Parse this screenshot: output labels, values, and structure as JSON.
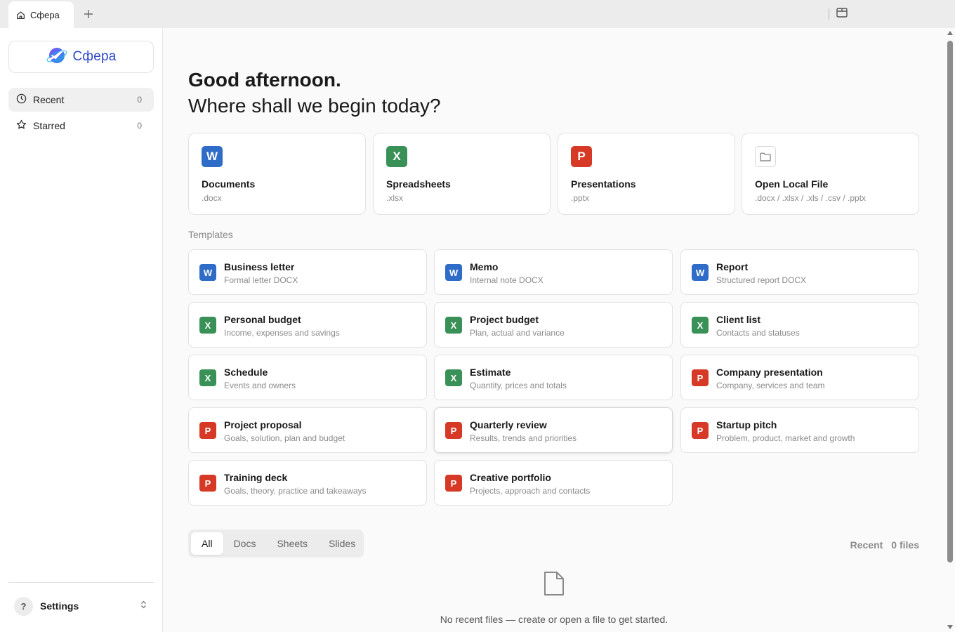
{
  "tabbar": {
    "tab_title": "Сфера",
    "tab_icon": "home-icon",
    "add_tab_icon": "plus-icon",
    "panel_icon": "sidebar-panel-icon"
  },
  "sidebar": {
    "logo_text": "Сфера",
    "logo_icon": "sphere-logo-icon",
    "nav": [
      {
        "label": "Recent",
        "count": "0",
        "icon": "clock-icon"
      },
      {
        "label": "Starred",
        "count": "0",
        "icon": "star-icon"
      }
    ],
    "settings": {
      "label": "Settings",
      "avatar": "?",
      "icon": "chevron-updown-icon"
    }
  },
  "main": {
    "greeting_line1": "Good afternoon.",
    "greeting_line2": "Where shall we begin today?",
    "quick": [
      {
        "letter": "W",
        "title": "Documents",
        "sub": ".docx",
        "color": "#2f6cc8"
      },
      {
        "letter": "X",
        "title": "Spreadsheets",
        "sub": ".xlsx",
        "color": "#3a9157"
      },
      {
        "letter": "P",
        "title": "Presentations",
        "sub": ".pptx",
        "color": "#d63a26"
      },
      {
        "letter": "",
        "title": "Open Local File",
        "sub": ".docx / .xlsx / .xls / .csv / .pptx",
        "icon": "folder-icon"
      }
    ],
    "templates_label": "Templates",
    "templates": [
      {
        "letter": "W",
        "title": "Business letter",
        "sub": "Formal letter DOCX"
      },
      {
        "letter": "W",
        "title": "Memo",
        "sub": "Internal note DOCX"
      },
      {
        "letter": "W",
        "title": "Report",
        "sub": "Structured report DOCX"
      },
      {
        "letter": "X",
        "title": "Personal budget",
        "sub": "Income, expenses and savings"
      },
      {
        "letter": "X",
        "title": "Project budget",
        "sub": "Plan, actual and variance"
      },
      {
        "letter": "X",
        "title": "Client list",
        "sub": "Contacts and statuses"
      },
      {
        "letter": "X",
        "title": "Schedule",
        "sub": "Events and owners"
      },
      {
        "letter": "X",
        "title": "Estimate",
        "sub": "Quantity, prices and totals"
      },
      {
        "letter": "P",
        "title": "Company presentation",
        "sub": "Company, services and team"
      },
      {
        "letter": "P",
        "title": "Project proposal",
        "sub": "Goals, solution, plan and budget"
      },
      {
        "letter": "P",
        "title": "Quarterly review",
        "sub": "Results, trends and priorities"
      },
      {
        "letter": "P",
        "title": "Startup pitch",
        "sub": "Problem, product, market and growth"
      },
      {
        "letter": "P",
        "title": "Training deck",
        "sub": "Goals, theory, practice and takeaways"
      },
      {
        "letter": "P",
        "title": "Creative portfolio",
        "sub": "Projects, approach and contacts"
      }
    ],
    "filters": [
      "All",
      "Docs",
      "Sheets",
      "Slides"
    ],
    "active_filter": "All",
    "recent_label": "Recent",
    "recent_count": "0 files",
    "empty_icon": "file-icon",
    "empty_text": "No recent files — create or open a file to get started."
  }
}
